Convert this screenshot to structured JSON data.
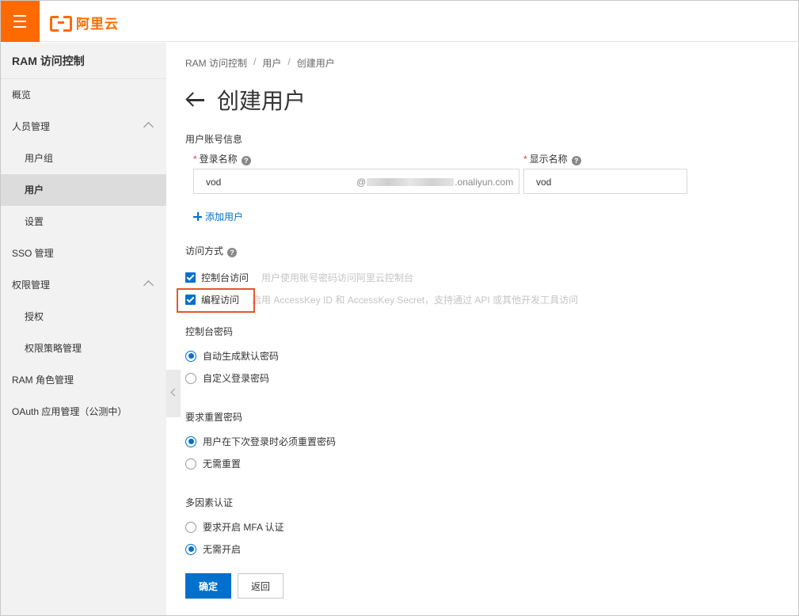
{
  "header": {
    "menu_icon": "hamburger-icon",
    "logo_text": "阿里云",
    "brand_color": "#ff6a00"
  },
  "sidebar": {
    "title": "RAM 访问控制",
    "items": [
      {
        "label": "概览"
      },
      {
        "label": "人员管理",
        "expanded": true
      },
      {
        "label": "用户组"
      },
      {
        "label": "用户",
        "active": true
      },
      {
        "label": "设置"
      },
      {
        "label": "SSO 管理"
      },
      {
        "label": "权限管理",
        "expanded": true
      },
      {
        "label": "授权"
      },
      {
        "label": "权限策略管理"
      },
      {
        "label": "RAM 角色管理"
      },
      {
        "label": "OAuth 应用管理（公测中）"
      }
    ]
  },
  "breadcrumb": [
    "RAM 访问控制",
    "用户",
    "创建用户"
  ],
  "page_title": "创建用户",
  "form": {
    "account_section": "用户账号信息",
    "login_name_label": "登录名称",
    "login_name_value": "vod",
    "login_domain_prefix": "@",
    "login_domain_suffix": ".onaliyun.com",
    "display_name_label": "显示名称",
    "display_name_value": "vod",
    "required_mark": "*",
    "help_mark": "?",
    "add_user": "添加用户",
    "access_section": "访问方式",
    "console_access": {
      "label": "控制台访问",
      "hint": "用户使用账号密码访问阿里云控制台",
      "checked": true
    },
    "programmatic_access": {
      "label": "编程访问",
      "hint": "启用 AccessKey ID 和 AccessKey Secret，支持通过 API 或其他开发工具访问",
      "checked": true
    },
    "console_password_section": "控制台密码",
    "password_options": [
      {
        "label": "自动生成默认密码",
        "selected": true
      },
      {
        "label": "自定义登录密码",
        "selected": false
      }
    ],
    "reset_section": "要求重置密码",
    "reset_options": [
      {
        "label": "用户在下次登录时必须重置密码",
        "selected": true
      },
      {
        "label": "无需重置",
        "selected": false
      }
    ],
    "mfa_section": "多因素认证",
    "mfa_options": [
      {
        "label": "要求开启 MFA 认证",
        "selected": false
      },
      {
        "label": "无需开启",
        "selected": true
      }
    ]
  },
  "buttons": {
    "confirm": "确定",
    "back": "返回"
  },
  "colors": {
    "primary": "#0070cc",
    "highlight": "#e4562f"
  }
}
